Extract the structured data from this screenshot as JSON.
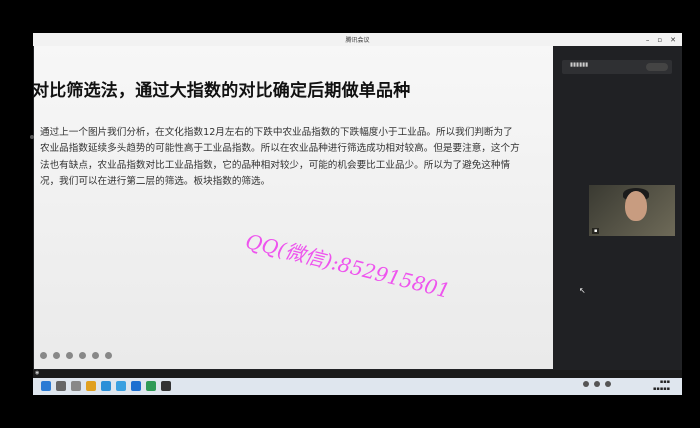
{
  "window": {
    "title": "腾讯会议"
  },
  "slide": {
    "title": "对比筛选法，通过大指数的对比确定后期做单品种",
    "body": "通过上一个图片我们分析，在文化指数12月左右的下跌中农业品指数的下跌幅度小于工业品。所以我们判断为了农业品指数延续多头趋势的可能性高于工业品指数。所以在农业品种进行筛选成功相对较高。但是要注意，这个方法也有缺点，农业品指数对比工业品指数，它的品种相对较少，可能的机会要比工业品少。所以为了避免这种情况，我们可以在进行第二层的筛选。板块指数的筛选。"
  },
  "watermark": "QQ(微信):852915801",
  "colors": {
    "watermark": "#ee44ee",
    "slide_bg": "#f2f2f2",
    "taskbar": "#dfe6ee"
  }
}
